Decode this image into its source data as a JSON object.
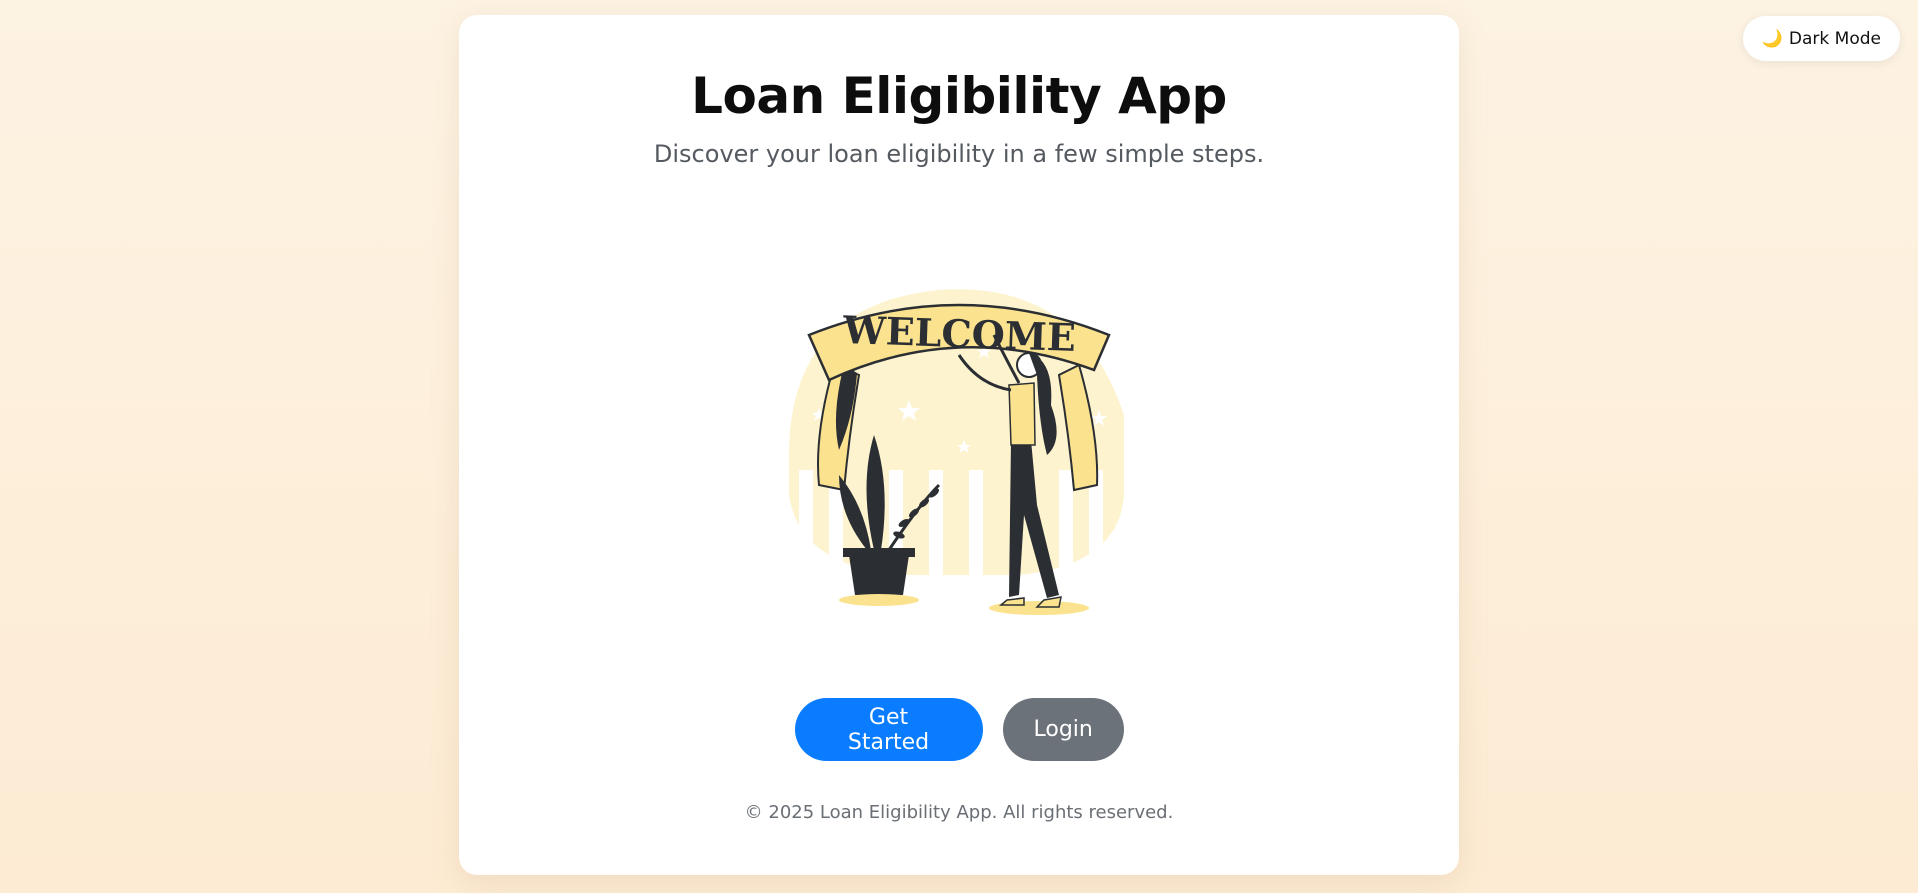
{
  "header": {
    "dark_mode_label": "Dark Mode",
    "dark_mode_icon": "moon-icon"
  },
  "main": {
    "title": "Loan Eligibility App",
    "subtitle": "Discover your loan eligibility in a few simple steps.",
    "illustration": {
      "banner_text": "WELCOME",
      "icon": "welcome-illustration"
    },
    "buttons": {
      "get_started": "Get Started",
      "login": "Login"
    }
  },
  "footer": {
    "text": "© 2025 Loan Eligibility App. All rights reserved."
  },
  "colors": {
    "primary": "#0a7cff",
    "secondary": "#6c727a",
    "accent_yellow": "#fbe28f",
    "ink": "#2b2f33"
  }
}
